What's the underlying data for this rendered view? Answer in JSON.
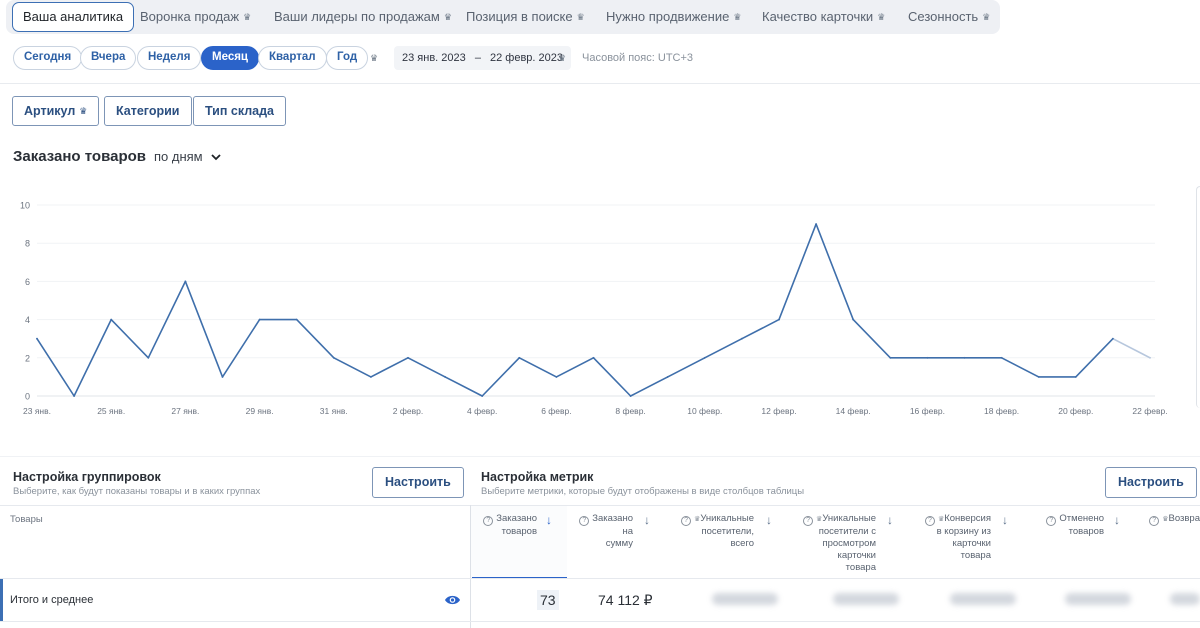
{
  "nav": {
    "tabs": [
      {
        "label": "Ваша аналитика",
        "active": true,
        "crown": false
      },
      {
        "label": "Воронка продаж",
        "crown": true
      },
      {
        "label": "Ваши лидеры по продажам",
        "crown": true
      },
      {
        "label": "Позиция в поиске",
        "crown": true
      },
      {
        "label": "Нужно продвижение",
        "crown": true
      },
      {
        "label": "Качество карточки",
        "crown": true
      },
      {
        "label": "Сезонность",
        "crown": true
      }
    ],
    "crown_glyph": "♛"
  },
  "periods": {
    "items": [
      "Сегодня",
      "Вчера",
      "Неделя",
      "Месяц",
      "Квартал",
      "Год"
    ],
    "selected": "Месяц",
    "date_from": "23 янв. 2023",
    "date_dash": "–",
    "date_to": "22 февр. 2023",
    "timezone": "Часовой пояс: UTC+3"
  },
  "filters": {
    "article": "Артикул",
    "categories": "Категории",
    "warehouse_type": "Тип склада"
  },
  "chart_section": {
    "title": "Заказано товаров",
    "mode": "по дням"
  },
  "chart_data": {
    "type": "line",
    "title": "",
    "xlabel": "",
    "ylabel": "",
    "ylim": [
      0,
      10
    ],
    "yticks": [
      0,
      2,
      4,
      6,
      8,
      10
    ],
    "x": [
      "23 янв.",
      "24 янв.",
      "25 янв.",
      "26 янв.",
      "27 янв.",
      "28 янв.",
      "29 янв.",
      "30 янв.",
      "31 янв.",
      "1 февр.",
      "2 февр.",
      "3 февр.",
      "4 февр.",
      "5 февр.",
      "6 февр.",
      "7 февр.",
      "8 февр.",
      "9 февр.",
      "10 февр.",
      "11 февр.",
      "12 февр.",
      "13 февр.",
      "14 февр.",
      "15 февр.",
      "16 февр.",
      "17 февр.",
      "18 февр.",
      "19 февр.",
      "20 февр.",
      "21 февр.",
      "22 февр."
    ],
    "xtick_labels": [
      "23 янв.",
      "25 янв.",
      "27 янв.",
      "29 янв.",
      "31 янв.",
      "2 февр.",
      "4 февр.",
      "6 февр.",
      "8 февр.",
      "10 февр.",
      "12 февр.",
      "14 февр.",
      "16 февр.",
      "18 февр.",
      "20 февр.",
      "22 февр."
    ],
    "series": [
      {
        "values": [
          3,
          0,
          4,
          2,
          6,
          1,
          4,
          4,
          2,
          1,
          2,
          1,
          0,
          2,
          1,
          2,
          0,
          1,
          2,
          3,
          4,
          9,
          4,
          2,
          2,
          2,
          2,
          1,
          1,
          3,
          2
        ]
      }
    ],
    "last_segment_faded": true,
    "grid": true,
    "line_color": "#3f6fab",
    "faded_color": "#b7c7dd"
  },
  "grouping": {
    "title": "Настройка группировок",
    "subtitle": "Выберите, как будут показаны товары и в каких группах",
    "button": "Настроить"
  },
  "metrics": {
    "title": "Настройка метрик",
    "subtitle": "Выберите метрики, которые будут отображены в виде столбцов таблицы",
    "button": "Настроить"
  },
  "table": {
    "goods_header": "Товары",
    "columns": [
      {
        "lines": [
          "Заказано",
          "товаров"
        ],
        "crown": false
      },
      {
        "lines": [
          "Заказано",
          "на",
          "сумму"
        ],
        "crown": false
      },
      {
        "lines": [
          "Уникальные",
          "посетители,",
          "всего"
        ],
        "crown": true
      },
      {
        "lines": [
          "Уникальные",
          "посетители с",
          "просмотром",
          "карточки",
          "товара"
        ],
        "crown": true
      },
      {
        "lines": [
          "Конверсия",
          "в корзину из",
          "карточки",
          "товара"
        ],
        "crown": true
      },
      {
        "lines": [
          "Отменено",
          "товаров"
        ],
        "crown": false
      },
      {
        "lines": [
          "Возвра"
        ],
        "crown": true
      }
    ],
    "total_row": {
      "label": "Итого и среднее",
      "ordered": "73",
      "sum": "74 112 ₽"
    },
    "question_glyph": "?",
    "arrow_glyph": "↓"
  },
  "colors": {
    "accent": "#2b63c9",
    "line": "#3f6fab"
  }
}
